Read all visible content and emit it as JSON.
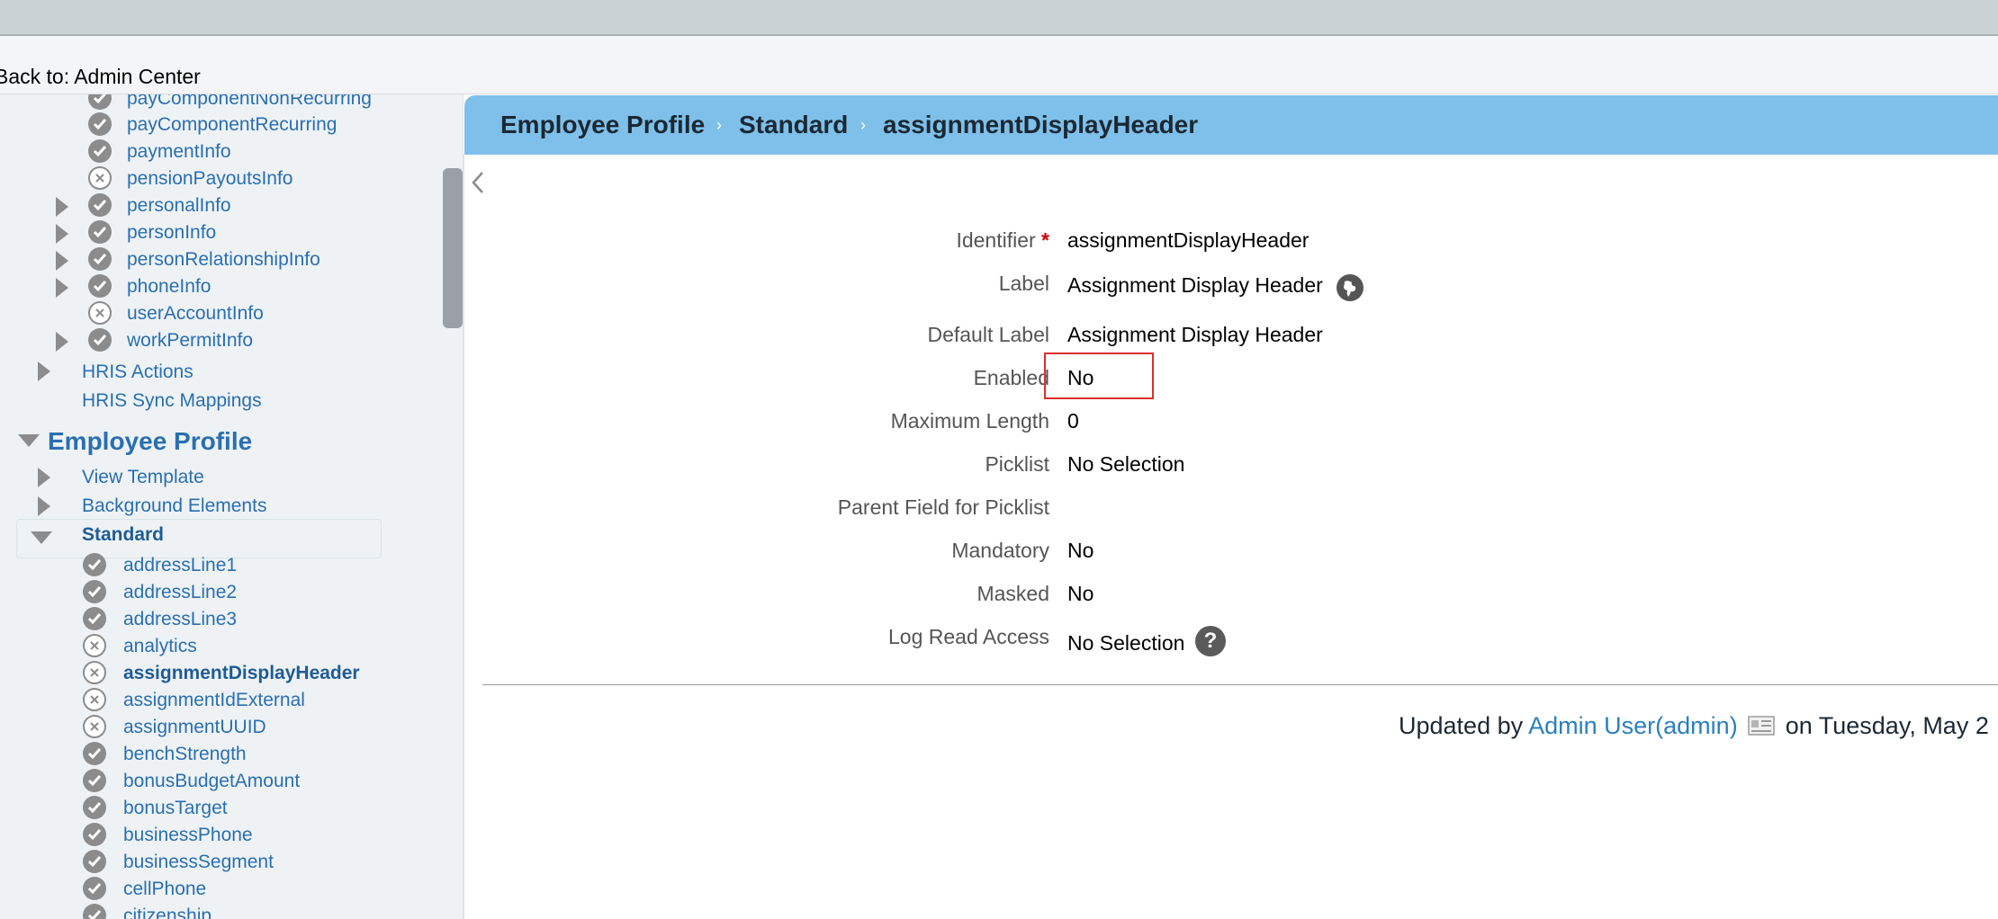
{
  "header": {
    "back_link": "Back to: Admin Center"
  },
  "sidebar": {
    "items_top": [
      {
        "label": "payComponentNonRecurring",
        "status": "ok",
        "expandable": false
      },
      {
        "label": "payComponentRecurring",
        "status": "ok",
        "expandable": false
      },
      {
        "label": "paymentInfo",
        "status": "ok",
        "expandable": false
      },
      {
        "label": "pensionPayoutsInfo",
        "status": "disabled",
        "expandable": false
      },
      {
        "label": "personalInfo",
        "status": "ok",
        "expandable": true
      },
      {
        "label": "personInfo",
        "status": "ok",
        "expandable": true
      },
      {
        "label": "personRelationshipInfo",
        "status": "ok",
        "expandable": true
      },
      {
        "label": "phoneInfo",
        "status": "ok",
        "expandable": true
      },
      {
        "label": "userAccountInfo",
        "status": "disabled",
        "expandable": false
      },
      {
        "label": "workPermitInfo",
        "status": "ok",
        "expandable": true
      }
    ],
    "hris_actions": "HRIS Actions",
    "hris_sync": "HRIS Sync Mappings",
    "section_title": "Employee Profile",
    "view_template": "View Template",
    "background_elements": "Background Elements",
    "standard": "Standard",
    "standard_items": [
      {
        "label": "addressLine1",
        "status": "ok"
      },
      {
        "label": "addressLine2",
        "status": "ok"
      },
      {
        "label": "addressLine3",
        "status": "ok"
      },
      {
        "label": "analytics",
        "status": "disabled"
      },
      {
        "label": "assignmentDisplayHeader",
        "status": "disabled",
        "selected": true
      },
      {
        "label": "assignmentIdExternal",
        "status": "disabled"
      },
      {
        "label": "assignmentUUID",
        "status": "disabled"
      },
      {
        "label": "benchStrength",
        "status": "ok"
      },
      {
        "label": "bonusBudgetAmount",
        "status": "ok"
      },
      {
        "label": "bonusTarget",
        "status": "ok"
      },
      {
        "label": "businessPhone",
        "status": "ok"
      },
      {
        "label": "businessSegment",
        "status": "ok"
      },
      {
        "label": "cellPhone",
        "status": "ok"
      },
      {
        "label": "citizenship",
        "status": "ok"
      }
    ]
  },
  "breadcrumb": [
    "Employee Profile",
    "Standard",
    "assignmentDisplayHeader"
  ],
  "fields": {
    "identifier_label": "Identifier",
    "identifier_required": "*",
    "identifier_value": "assignmentDisplayHeader",
    "label_label": "Label",
    "label_value": "Assignment Display Header",
    "default_label_label": "Default Label",
    "default_label_value": "Assignment Display Header",
    "enabled_label": "Enabled",
    "enabled_value": "No",
    "max_length_label": "Maximum Length",
    "max_length_value": "0",
    "picklist_label": "Picklist",
    "picklist_value": "No Selection",
    "parent_field_label": "Parent Field for Picklist",
    "parent_field_value": "",
    "mandatory_label": "Mandatory",
    "mandatory_value": "No",
    "masked_label": "Masked",
    "masked_value": "No",
    "log_read_label": "Log Read Access",
    "log_read_value": "No Selection",
    "help_glyph": "?"
  },
  "footer": {
    "prefix": "Updated by",
    "user": "Admin User(admin)",
    "suffix": "on Tuesday, May 2"
  },
  "colors": {
    "header_bg": "#7ec0ea",
    "link": "#2a6fb0",
    "highlight": "#d9302b"
  }
}
